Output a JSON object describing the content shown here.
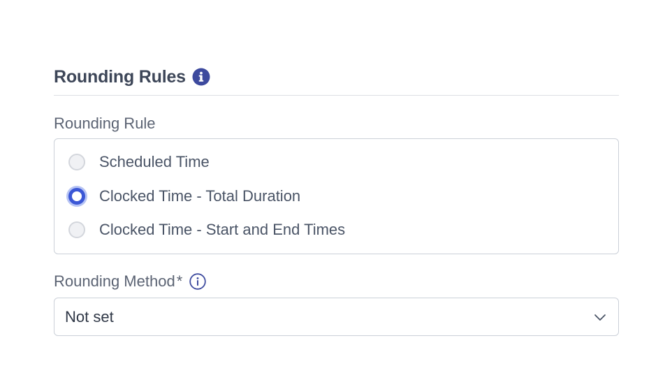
{
  "section": {
    "title": "Rounding Rules"
  },
  "rounding_rule": {
    "label": "Rounding Rule",
    "options": [
      {
        "label": "Scheduled Time",
        "checked": false
      },
      {
        "label": "Clocked Time - Total Duration",
        "checked": true
      },
      {
        "label": "Clocked Time - Start and End Times",
        "checked": false
      }
    ]
  },
  "rounding_method": {
    "label": "Rounding Method",
    "required_mark": "*",
    "value": "Not set"
  },
  "colors": {
    "accent": "#3b57d6",
    "info_icon": "#3d4a9e",
    "border": "#cbd0d8"
  },
  "icons": {
    "section_info": "info-filled-icon",
    "method_info": "info-outline-icon",
    "select_caret": "chevron-down-icon"
  }
}
